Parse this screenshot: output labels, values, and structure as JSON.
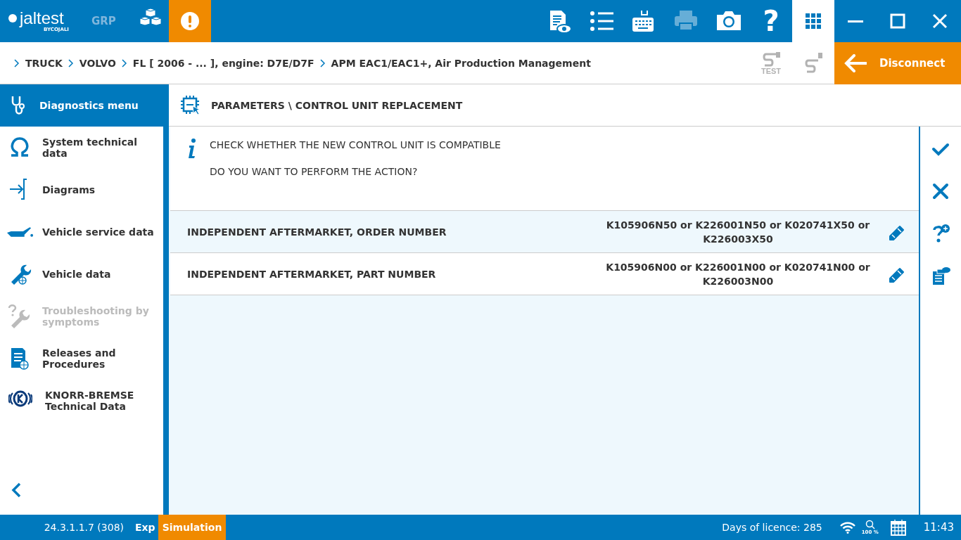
{
  "header": {
    "logo": {
      "brand": "jaltest",
      "sub": "BYCOJALI"
    },
    "mode": "GRP",
    "toolbar": [
      {
        "kind": "document-eye",
        "disabled": false
      },
      {
        "kind": "list",
        "disabled": false
      },
      {
        "kind": "keyboard",
        "disabled": false
      },
      {
        "kind": "printer",
        "disabled": true
      },
      {
        "kind": "camera",
        "disabled": false
      },
      {
        "kind": "help",
        "label": "?",
        "disabled": false
      }
    ],
    "apps_selected": true
  },
  "breadcrumb": [
    "TRUCK",
    "VOLVO",
    "FL [ 2006 - ... ], engine: D7E/D7F",
    "APM EAC1/EAC1+, Air Production Management"
  ],
  "connection_tools": [
    {
      "kind": "test",
      "label": "TEST",
      "disabled": true
    },
    {
      "kind": "cable",
      "disabled": true
    }
  ],
  "disconnect": "Disconnect",
  "sidebar": {
    "title": "Diagnostics menu",
    "items": [
      {
        "kind": "omega",
        "label": "System technical data",
        "disabled": false
      },
      {
        "kind": "diagrams",
        "label": "Diagrams",
        "disabled": false
      },
      {
        "kind": "oil",
        "label": "Vehicle service data",
        "disabled": false
      },
      {
        "kind": "wrench",
        "label": "Vehicle data",
        "disabled": false
      },
      {
        "kind": "troubleshoot",
        "label": "Troubleshooting by symptoms",
        "disabled": true
      },
      {
        "kind": "releases",
        "label": "Releases and Procedures",
        "disabled": false
      },
      {
        "kind": "knorr",
        "label": "KNORR-BREMSE Technical Data",
        "disabled": false
      }
    ]
  },
  "page_title": "PARAMETERS \\ CONTROL UNIT REPLACEMENT",
  "messages": [
    "CHECK WHETHER THE NEW CONTROL UNIT IS COMPATIBLE",
    "DO YOU WANT TO PERFORM THE ACTION?"
  ],
  "parameters": [
    {
      "label": "INDEPENDENT AFTERMARKET, ORDER NUMBER",
      "value": "K105906N50 or K226001N50 or K020741X50 or K226003X50",
      "selected": true
    },
    {
      "label": "INDEPENDENT AFTERMARKET, PART NUMBER",
      "value": "K105906N00 or K226001N00 or K020741N00 or K226003N00",
      "selected": false
    }
  ],
  "side_actions": [
    {
      "kind": "confirm"
    },
    {
      "kind": "cancel"
    },
    {
      "kind": "help-plus"
    },
    {
      "kind": "documents"
    }
  ],
  "status_bar": {
    "version": "24.3.1.1.7 (308)",
    "exp": "Exp",
    "mode": "Simulation",
    "licence": "Days of licence: 285",
    "zoom": "100 %",
    "time": "11:43"
  }
}
